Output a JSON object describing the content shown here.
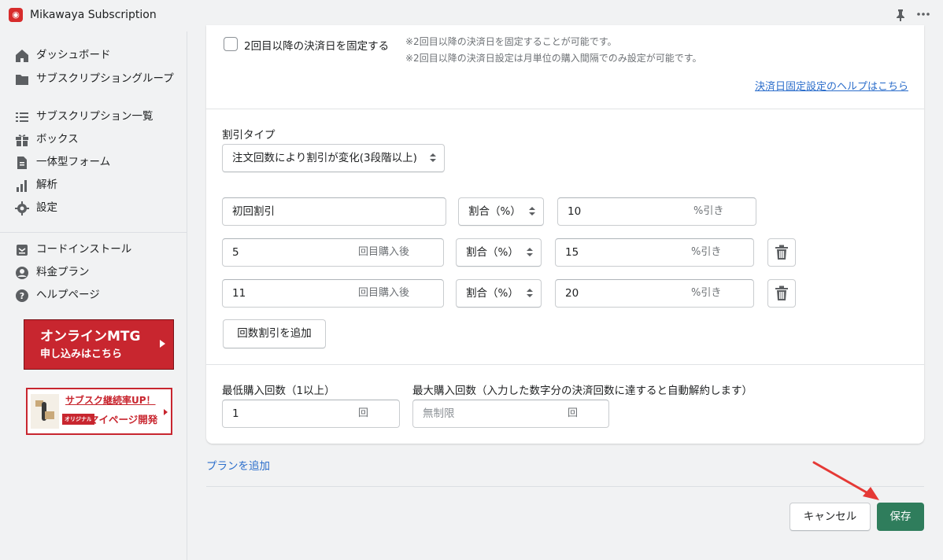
{
  "app": {
    "title": "Mikawaya Subscription",
    "logo_glyph": "◉",
    "pin_glyph": "📌",
    "more_glyph": "•••"
  },
  "sidebar": {
    "items": [
      {
        "label": "ダッシュボード",
        "icon": "home-icon"
      },
      {
        "label": "サブスクリプショングループ",
        "icon": "folder-icon"
      },
      {
        "label": "サブスクリプション一覧",
        "icon": "list-icon"
      },
      {
        "label": "ボックス",
        "icon": "gift-icon"
      },
      {
        "label": "一体型フォーム",
        "icon": "document-icon"
      },
      {
        "label": "解析",
        "icon": "bar-chart-icon"
      },
      {
        "label": "設定",
        "icon": "gear-icon"
      },
      {
        "label": "コードインストール",
        "icon": "install-icon"
      },
      {
        "label": "料金プラン",
        "icon": "user-circle-icon"
      },
      {
        "label": "ヘルプページ",
        "icon": "question-icon"
      }
    ],
    "banner_mtg": {
      "line1": "オンラインMTG",
      "line2": "申し込みはこちら"
    },
    "banner_mypage": {
      "line1": "サブスク継続率UP！",
      "tag": "オリジナル",
      "line2": "マイページ開発"
    }
  },
  "payment_date": {
    "checkbox_label": "2回目以降の決済日を固定する",
    "checked": false,
    "note1": "※2回目以降の決済日を固定することが可能です。",
    "note2": "※2回目以降の決済日設定は月単位の購入間隔でのみ設定が可能です。",
    "help_link": "決済日固定設定のヘルプはこちら"
  },
  "discount": {
    "type_label": "割引タイプ",
    "type_value": "注文回数により割引が変化(3段階以上)",
    "first": {
      "label": "初回割引",
      "unit_select": "割合（%）",
      "value": "10",
      "suffix": "%引き"
    },
    "rows": [
      {
        "count": "5",
        "count_suffix": "回目購入後",
        "unit_select": "割合（%）",
        "value": "15",
        "suffix": "%引き"
      },
      {
        "count": "11",
        "count_suffix": "回目購入後",
        "unit_select": "割合（%）",
        "value": "20",
        "suffix": "%引き"
      }
    ],
    "add_button": "回数割引を追加"
  },
  "purchase_counts": {
    "min_label": "最低購入回数（1以上）",
    "min_value": "1",
    "min_suffix": "回",
    "max_label": "最大購入回数（入力した数字分の決済回数に達すると自動解約します）",
    "max_placeholder": "無制限",
    "max_suffix": "回"
  },
  "footer": {
    "add_plan": "プランを追加",
    "cancel": "キャンセル",
    "save": "保存"
  },
  "colors": {
    "save_button": "#2f7d5c",
    "link": "#2c6ecb",
    "annotation_arrow": "#e53935",
    "banner_red": "#c8262f"
  }
}
